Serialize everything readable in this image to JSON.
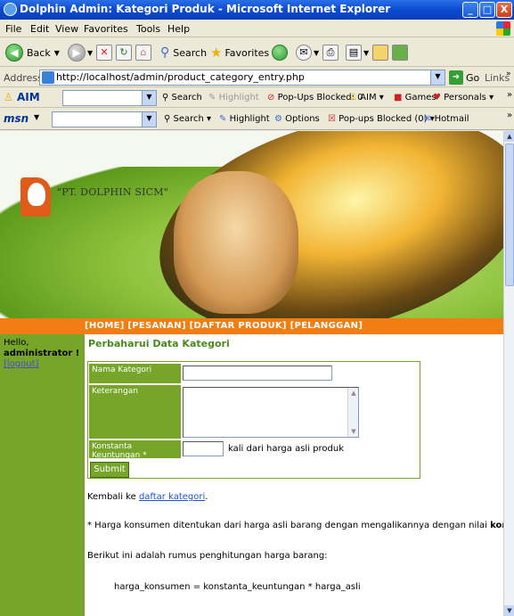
{
  "window": {
    "title": "Dolphin Admin: Kategori Produk - Microsoft Internet Explorer",
    "minimize": "_",
    "maximize": "□",
    "close": "X"
  },
  "menu": {
    "items": [
      "File",
      "Edit",
      "View",
      "Favorites",
      "Tools",
      "Help"
    ]
  },
  "toolbar": {
    "back": "Back",
    "search": "Search",
    "favorites": "Favorites"
  },
  "address": {
    "label": "Address",
    "url": "http://localhost/admin/product_category_entry.php",
    "go": "Go",
    "links": "Links"
  },
  "aimbar": {
    "logo": "AIM",
    "search": "Search",
    "highlight": "Highlight",
    "popups": "Pop-Ups Blocked: 0",
    "aim_menu": "AIM",
    "games": "Games",
    "personals": "Personals"
  },
  "msnbar": {
    "logo": "msn",
    "search": "Search",
    "highlight": "Highlight",
    "options": "Options",
    "popups": "Pop-ups Blocked (0)",
    "hotmail": "Hotmail"
  },
  "banner": {
    "company": "\"PT. DOLPHIN SICM\""
  },
  "nav": {
    "home": "[HOME]",
    "pesanan": "[PESANAN]",
    "daftar_produk": "[DAFTAR PRODUK]",
    "pelanggan": "[PELANGGAN]"
  },
  "sidebar": {
    "hello": "Hello,",
    "user": "administrator !",
    "logout": "[logout]"
  },
  "main": {
    "heading": "Perbaharui Data Kategori",
    "form": {
      "nama_label": "Nama Kategori",
      "nama_value": "",
      "keterangan_label": "Keterangan",
      "keterangan_value": "",
      "konstanta_label": "Konstanta Keuntungan *",
      "konstanta_value": "",
      "konstanta_suffix": "kali dari harga asli produk",
      "submit": "Submit"
    },
    "back_prefix": "Kembali ke ",
    "back_link": "daftar kategori",
    "back_suffix": ".",
    "note_prefix": "* Harga konsumen ditentukan dari harga asli barang dengan mengalikannya dengan nilai ",
    "note_bold": "konstanta keuntung",
    "rumus_intro": "Berikut ini adalah rumus penghitungan harga barang:",
    "formula": "harga_konsumen = konstanta_keuntungan * harga_asli"
  }
}
